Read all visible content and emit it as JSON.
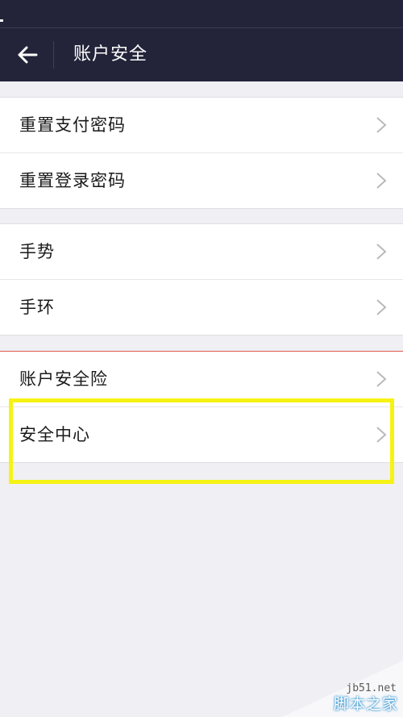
{
  "nav": {
    "title": "账户安全",
    "back_icon": "arrow-left-icon"
  },
  "groups": [
    {
      "items": [
        {
          "label": "重置支付密码",
          "icon": "chevron-right-icon"
        },
        {
          "label": "重置登录密码",
          "icon": "chevron-right-icon"
        }
      ]
    },
    {
      "items": [
        {
          "label": "手势",
          "icon": "chevron-right-icon"
        },
        {
          "label": "手环",
          "icon": "chevron-right-icon"
        }
      ]
    },
    {
      "items": [
        {
          "label": "账户安全险",
          "icon": "chevron-right-icon"
        },
        {
          "label": "安全中心",
          "icon": "chevron-right-icon"
        }
      ]
    }
  ],
  "highlight_color": "#f6f314",
  "nav_color": "#23243a",
  "watermark": {
    "url": "jb51.net",
    "name": "脚本之家"
  }
}
